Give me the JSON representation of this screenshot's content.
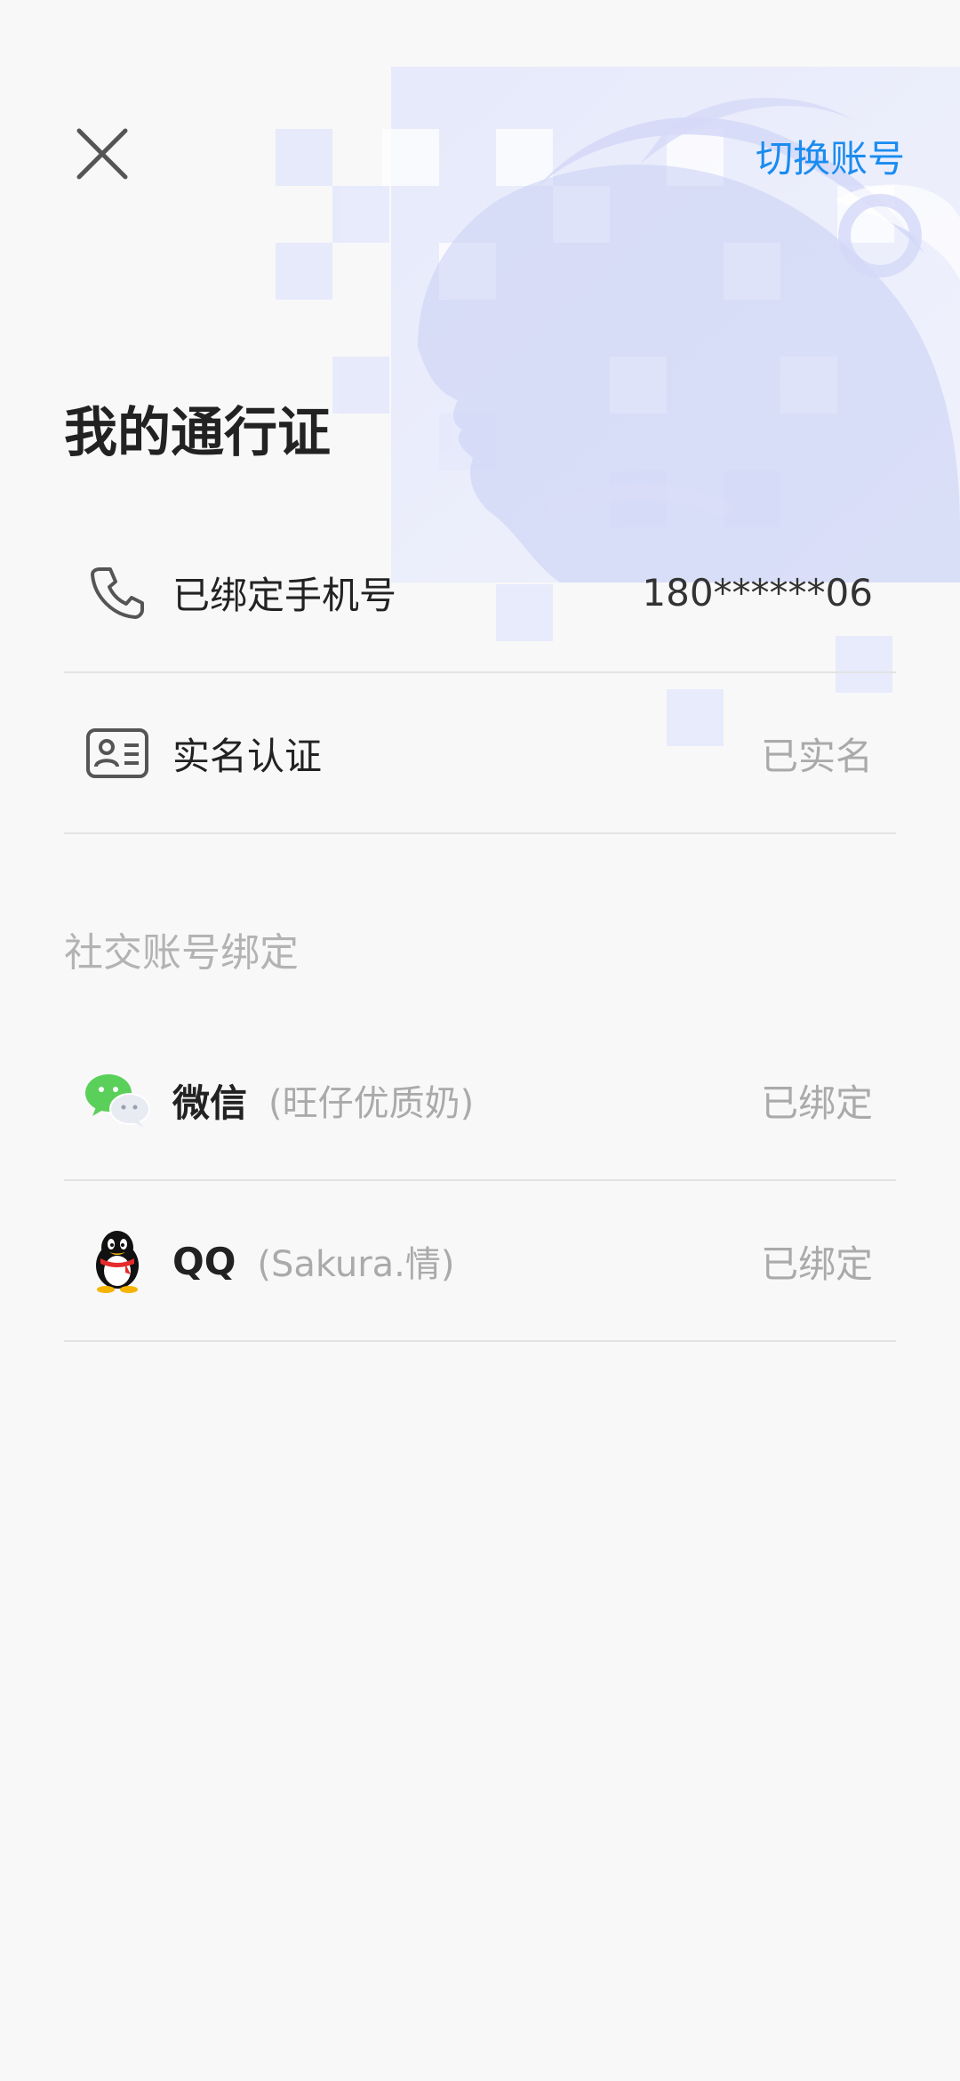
{
  "header": {
    "close_icon": "close-icon",
    "switch_account_label": "切换账号"
  },
  "title": "我的通行证",
  "account": [
    {
      "icon": "phone-icon",
      "label": "已绑定手机号",
      "value": "180******06"
    },
    {
      "icon": "id-card-icon",
      "label": "实名认证",
      "value": "已实名"
    }
  ],
  "social": {
    "section_title": "社交账号绑定",
    "items": [
      {
        "icon": "wechat-icon",
        "label": "微信",
        "nickname": "(旺仔优质奶)",
        "status": "已绑定"
      },
      {
        "icon": "qq-icon",
        "label": "QQ",
        "nickname": "(Sakura.情)",
        "status": "已绑定"
      }
    ]
  },
  "colors": {
    "accent": "#1a8cf0",
    "background": "#f8f8f8",
    "wechat_green": "#5ad05a",
    "qq_red": "#e52b2b"
  }
}
